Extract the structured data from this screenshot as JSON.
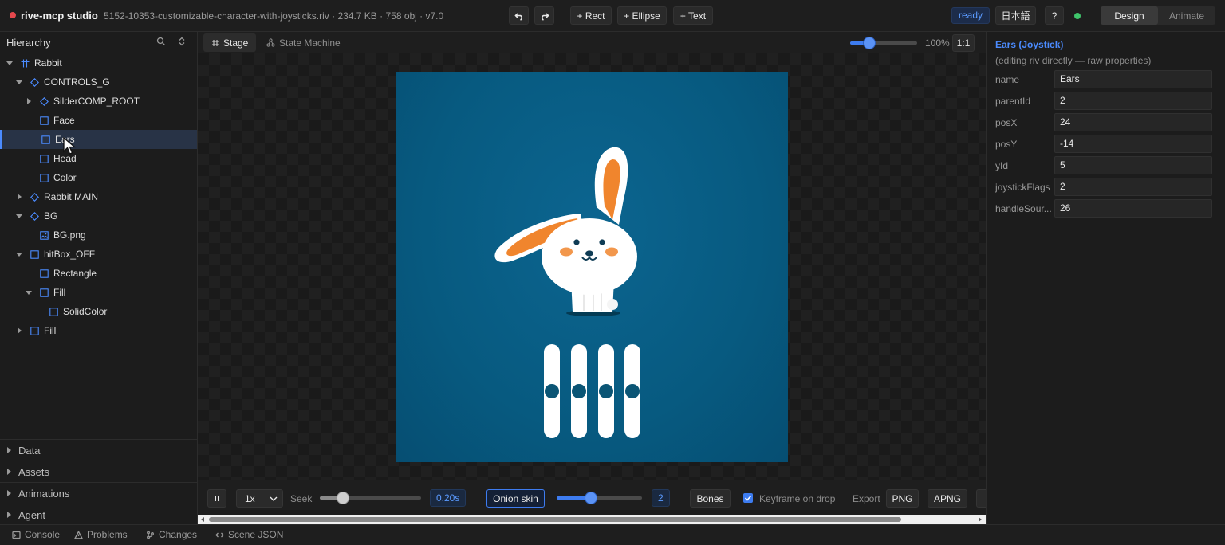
{
  "app": {
    "title": "rive-mcp studio",
    "file_info": "5152-10353-customizable-character-with-joysticks.riv · 234.7 KB · 758 obj · v7.0"
  },
  "toolbar": {
    "add_rect": "+ Rect",
    "add_ellipse": "+ Ellipse",
    "add_text": "+ Text",
    "status": "ready",
    "language": "日本語",
    "help": "?",
    "mode_design": "Design",
    "mode_animate": "Animate"
  },
  "hierarchy": {
    "title": "Hierarchy",
    "items": [
      {
        "label": "Rabbit",
        "icon": "artboard-icon"
      },
      {
        "label": "CONTROLS_G",
        "icon": "group-icon"
      },
      {
        "label": "SilderCOMP_ROOT",
        "icon": "group-icon"
      },
      {
        "label": "Face",
        "icon": "shape-icon"
      },
      {
        "label": "Ears",
        "icon": "shape-icon"
      },
      {
        "label": "Head",
        "icon": "shape-icon"
      },
      {
        "label": "Color",
        "icon": "shape-icon"
      },
      {
        "label": "Rabbit MAIN",
        "icon": "group-icon"
      },
      {
        "label": "BG",
        "icon": "group-icon"
      },
      {
        "label": "BG.png",
        "icon": "image-icon"
      },
      {
        "label": "hitBox_OFF",
        "icon": "shape-icon"
      },
      {
        "label": "Rectangle",
        "icon": "shape-icon"
      },
      {
        "label": "Fill",
        "icon": "shape-icon"
      },
      {
        "label": "SolidColor",
        "icon": "shape-icon"
      },
      {
        "label": "Fill",
        "icon": "shape-icon"
      }
    ],
    "selected": "Ears"
  },
  "sections": {
    "data": "Data",
    "assets": "Assets",
    "animations": "Animations",
    "agent": "Agent"
  },
  "tabs": {
    "stage": "Stage",
    "state_machine": "State Machine"
  },
  "zoom": {
    "value_label": "100%",
    "fit_label": "1:1",
    "level": 0.28
  },
  "playback": {
    "speed": "1x",
    "seek_label": "Seek",
    "seek_position": 0.23,
    "time": "0.20s",
    "onion_skin": "Onion skin",
    "onion_level": 0.4,
    "onion_count": "2",
    "bones": "Bones",
    "keyframe_on_drop": "Keyframe on drop",
    "keyframe_checked": true,
    "export_label": "Export",
    "export_png": "PNG",
    "export_apng": "APNG"
  },
  "properties": {
    "title": "Ears (Joystick)",
    "subtitle": "(editing riv directly — raw properties)",
    "fields": [
      {
        "name": "name",
        "value": "Ears"
      },
      {
        "name": "parentId",
        "value": "2"
      },
      {
        "name": "posX",
        "value": "24"
      },
      {
        "name": "posY",
        "value": "-14"
      },
      {
        "name": "yId",
        "value": "5"
      },
      {
        "name": "joystickFlags",
        "value": "2"
      },
      {
        "name": "handleSour...",
        "value": "26"
      }
    ]
  },
  "bottom": {
    "console": "Console",
    "problems": "Problems",
    "changes": "Changes",
    "scene_json": "Scene JSON"
  },
  "colors": {
    "accent": "#4b8bff",
    "artboard_bg": "#075a80",
    "rabbit_ear_inner": "#f0852d",
    "status_green": "#3fc56b"
  }
}
